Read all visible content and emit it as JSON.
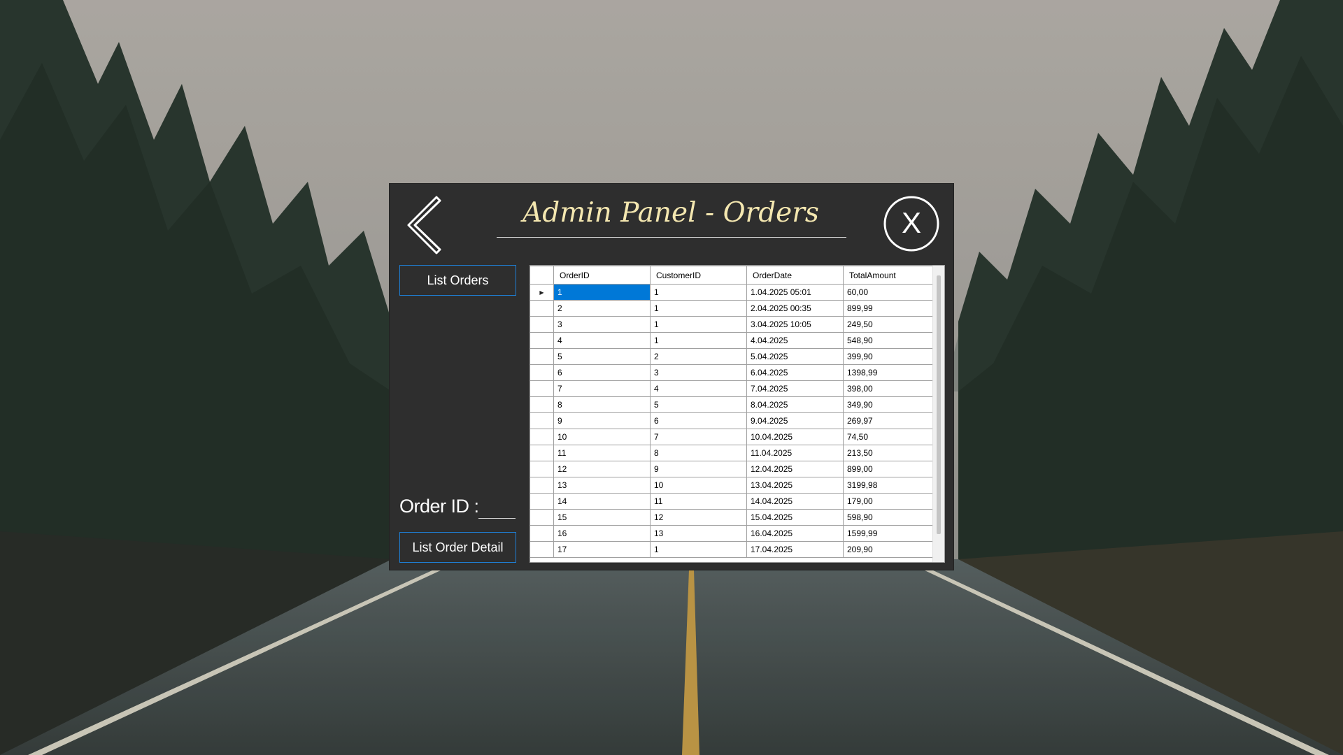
{
  "window": {
    "title": "Admin Panel - Orders"
  },
  "buttons": {
    "list_orders": "List Orders",
    "list_order_detail": "List Order Detail"
  },
  "order_id": {
    "label": "Order ID :",
    "value": ""
  },
  "grid": {
    "columns": [
      "OrderID",
      "CustomerID",
      "OrderDate",
      "TotalAmount"
    ],
    "selected_row": 0,
    "rows": [
      [
        "1",
        "1",
        "1.04.2025 05:01",
        "60,00"
      ],
      [
        "2",
        "1",
        "2.04.2025 00:35",
        "899,99"
      ],
      [
        "3",
        "1",
        "3.04.2025 10:05",
        "249,50"
      ],
      [
        "4",
        "1",
        "4.04.2025",
        "548,90"
      ],
      [
        "5",
        "2",
        "5.04.2025",
        "399,90"
      ],
      [
        "6",
        "3",
        "6.04.2025",
        "1398,99"
      ],
      [
        "7",
        "4",
        "7.04.2025",
        "398,00"
      ],
      [
        "8",
        "5",
        "8.04.2025",
        "349,90"
      ],
      [
        "9",
        "6",
        "9.04.2025",
        "269,97"
      ],
      [
        "10",
        "7",
        "10.04.2025",
        "74,50"
      ],
      [
        "11",
        "8",
        "11.04.2025",
        "213,50"
      ],
      [
        "12",
        "9",
        "12.04.2025",
        "899,00"
      ],
      [
        "13",
        "10",
        "13.04.2025",
        "3199,98"
      ],
      [
        "14",
        "11",
        "14.04.2025",
        "179,00"
      ],
      [
        "15",
        "12",
        "15.04.2025",
        "598,90"
      ],
      [
        "16",
        "13",
        "16.04.2025",
        "1599,99"
      ],
      [
        "17",
        "1",
        "17.04.2025",
        "209,90"
      ]
    ]
  },
  "icons": {
    "back": "chevron-left-icon",
    "close": "close-circle-icon",
    "row_pointer": "triangle-right-icon"
  },
  "colors": {
    "window_bg": "#2e2e2e",
    "title_text": "#f4e7b0",
    "button_border": "#1e7fd6",
    "selection": "#0078d7"
  }
}
